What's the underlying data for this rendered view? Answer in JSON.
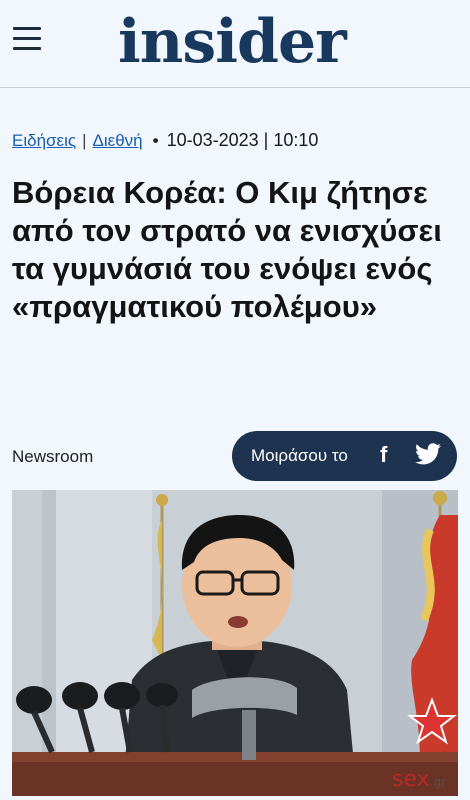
{
  "header": {
    "logo_text": "insider"
  },
  "meta": {
    "category1": "Ειδήσεις",
    "separator": "|",
    "category2": "Διεθνή",
    "bullet": "•",
    "datetime": "10-03-2023 | 10:10"
  },
  "article": {
    "headline": "Βόρεια Κορέα: Ο Κιμ ζήτησε από τον στρατό να ενισχύσει τα γυμνάσιά του ενόψει ενός «πραγματικού πολέμου»",
    "author": "Newsroom"
  },
  "share": {
    "label": "Μοιράσου το",
    "facebook_glyph": "f",
    "icons": [
      "facebook-icon",
      "twitter-icon"
    ]
  },
  "photo": {
    "watermark": "sex",
    "watermark_tld": ".gr"
  },
  "colors": {
    "brand": "#19385e",
    "share_bg": "#1e3350",
    "link": "#1b5cb0",
    "page_bg": "#f1f7fc"
  }
}
